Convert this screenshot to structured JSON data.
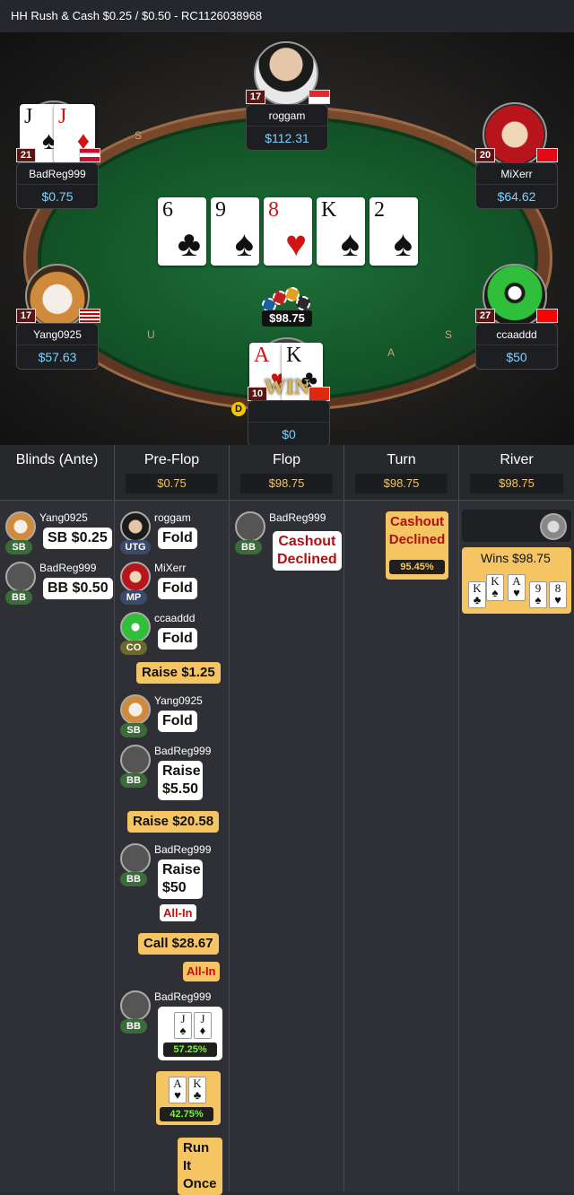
{
  "header": {
    "title": "HH  Rush & Cash $0.25 / $0.50    - RC1126038968"
  },
  "table": {
    "rail_letters": [
      "S",
      "U",
      "A",
      "S"
    ],
    "pot": "$98.75",
    "board": [
      {
        "rank": "6",
        "suit": "♣",
        "red": false
      },
      {
        "rank": "9",
        "suit": "♠",
        "red": false
      },
      {
        "rank": "8",
        "suit": "♥",
        "red": true
      },
      {
        "rank": "K",
        "suit": "♠",
        "red": false
      },
      {
        "rank": "2",
        "suit": "♠",
        "red": false
      }
    ],
    "seats": {
      "roggam": {
        "name": "roggam",
        "stack": "$112.31",
        "level": "17"
      },
      "badreg": {
        "name": "BadReg999",
        "stack": "$0.75",
        "level": "21",
        "cards": [
          {
            "rank": "J",
            "suit": "♠"
          },
          {
            "rank": "J",
            "suit": "♦"
          }
        ]
      },
      "mixerr": {
        "name": "MiXerr",
        "stack": "$64.62",
        "level": "20"
      },
      "yang": {
        "name": "Yang0925",
        "stack": "$57.63",
        "level": "17"
      },
      "ccaaddd": {
        "name": "ccaaddd",
        "stack": "$50",
        "level": "27"
      },
      "hero": {
        "name": "",
        "stack": "$0",
        "level": "10",
        "dealer": "D",
        "win": "WIN",
        "cards": [
          {
            "rank": "A",
            "suit": "♥"
          },
          {
            "rank": "K",
            "suit": "♣"
          }
        ]
      }
    },
    "colors": {
      "felt": "#135628",
      "stack": "#7ad3ff",
      "pot": "#f5c463"
    }
  },
  "history": {
    "columns": [
      {
        "title": "Blinds (Ante)",
        "pot": ""
      },
      {
        "title": "Pre-Flop",
        "pot": "$0.75"
      },
      {
        "title": "Flop",
        "pot": "$98.75"
      },
      {
        "title": "Turn",
        "pot": "$98.75"
      },
      {
        "title": "River",
        "pot": "$98.75"
      }
    ],
    "blinds": [
      {
        "name": "Yang0925",
        "pos": "SB",
        "action": "SB $0.25"
      },
      {
        "name": "BadReg999",
        "pos": "BB",
        "action": "BB $0.50"
      }
    ],
    "preflop": {
      "roggam": {
        "name": "roggam",
        "pos": "UTG",
        "action": "Fold"
      },
      "mixerr": {
        "name": "MiXerr",
        "pos": "MP",
        "action": "Fold"
      },
      "ccaaddd": {
        "name": "ccaaddd",
        "pos": "CO",
        "action": "Fold"
      },
      "raise1": "Raise $1.25",
      "yang": {
        "name": "Yang0925",
        "pos": "SB",
        "action": "Fold"
      },
      "badreg1": {
        "name": "BadReg999",
        "pos": "BB",
        "action_l1": "Raise",
        "action_l2": "$5.50"
      },
      "raise2": "Raise $20.58",
      "badreg2": {
        "name": "BadReg999",
        "pos": "BB",
        "action_l1": "Raise",
        "action_l2": "$50",
        "allin": "All-In"
      },
      "call": "Call $28.67",
      "hero_allin": "All-In",
      "badreg3": {
        "name": "BadReg999",
        "pos": "BB",
        "cards": [
          {
            "rank": "J",
            "suit": "♠"
          },
          {
            "rank": "J",
            "suit": "♦"
          }
        ],
        "equity": "57.25%"
      },
      "hero_cards": [
        {
          "rank": "A",
          "suit": "♥"
        },
        {
          "rank": "K",
          "suit": "♣"
        }
      ],
      "hero_equity": "42.75%",
      "run_l1": "Run It",
      "run_l2": "Once"
    },
    "flop": {
      "name": "BadReg999",
      "pos": "BB",
      "action_l1": "Cashout",
      "action_l2": "Declined"
    },
    "turn": {
      "action_l1": "Cashout",
      "action_l2": "Declined",
      "equity": "95.45%"
    },
    "river": {
      "wins": "Wins $98.75",
      "cards": [
        {
          "rank": "K",
          "suit": "♣"
        },
        {
          "rank": "K",
          "suit": "♠"
        },
        {
          "rank": "A",
          "suit": "♥"
        },
        {
          "rank": "9",
          "suit": "♠"
        },
        {
          "rank": "8",
          "suit": "♥"
        }
      ]
    },
    "positions": {
      "SB": "#3b6b3a",
      "BB": "#3b6b3a",
      "UTG": "#3a4a6b",
      "MP": "#3a4a6b",
      "CO": "#6b6a2a"
    }
  }
}
